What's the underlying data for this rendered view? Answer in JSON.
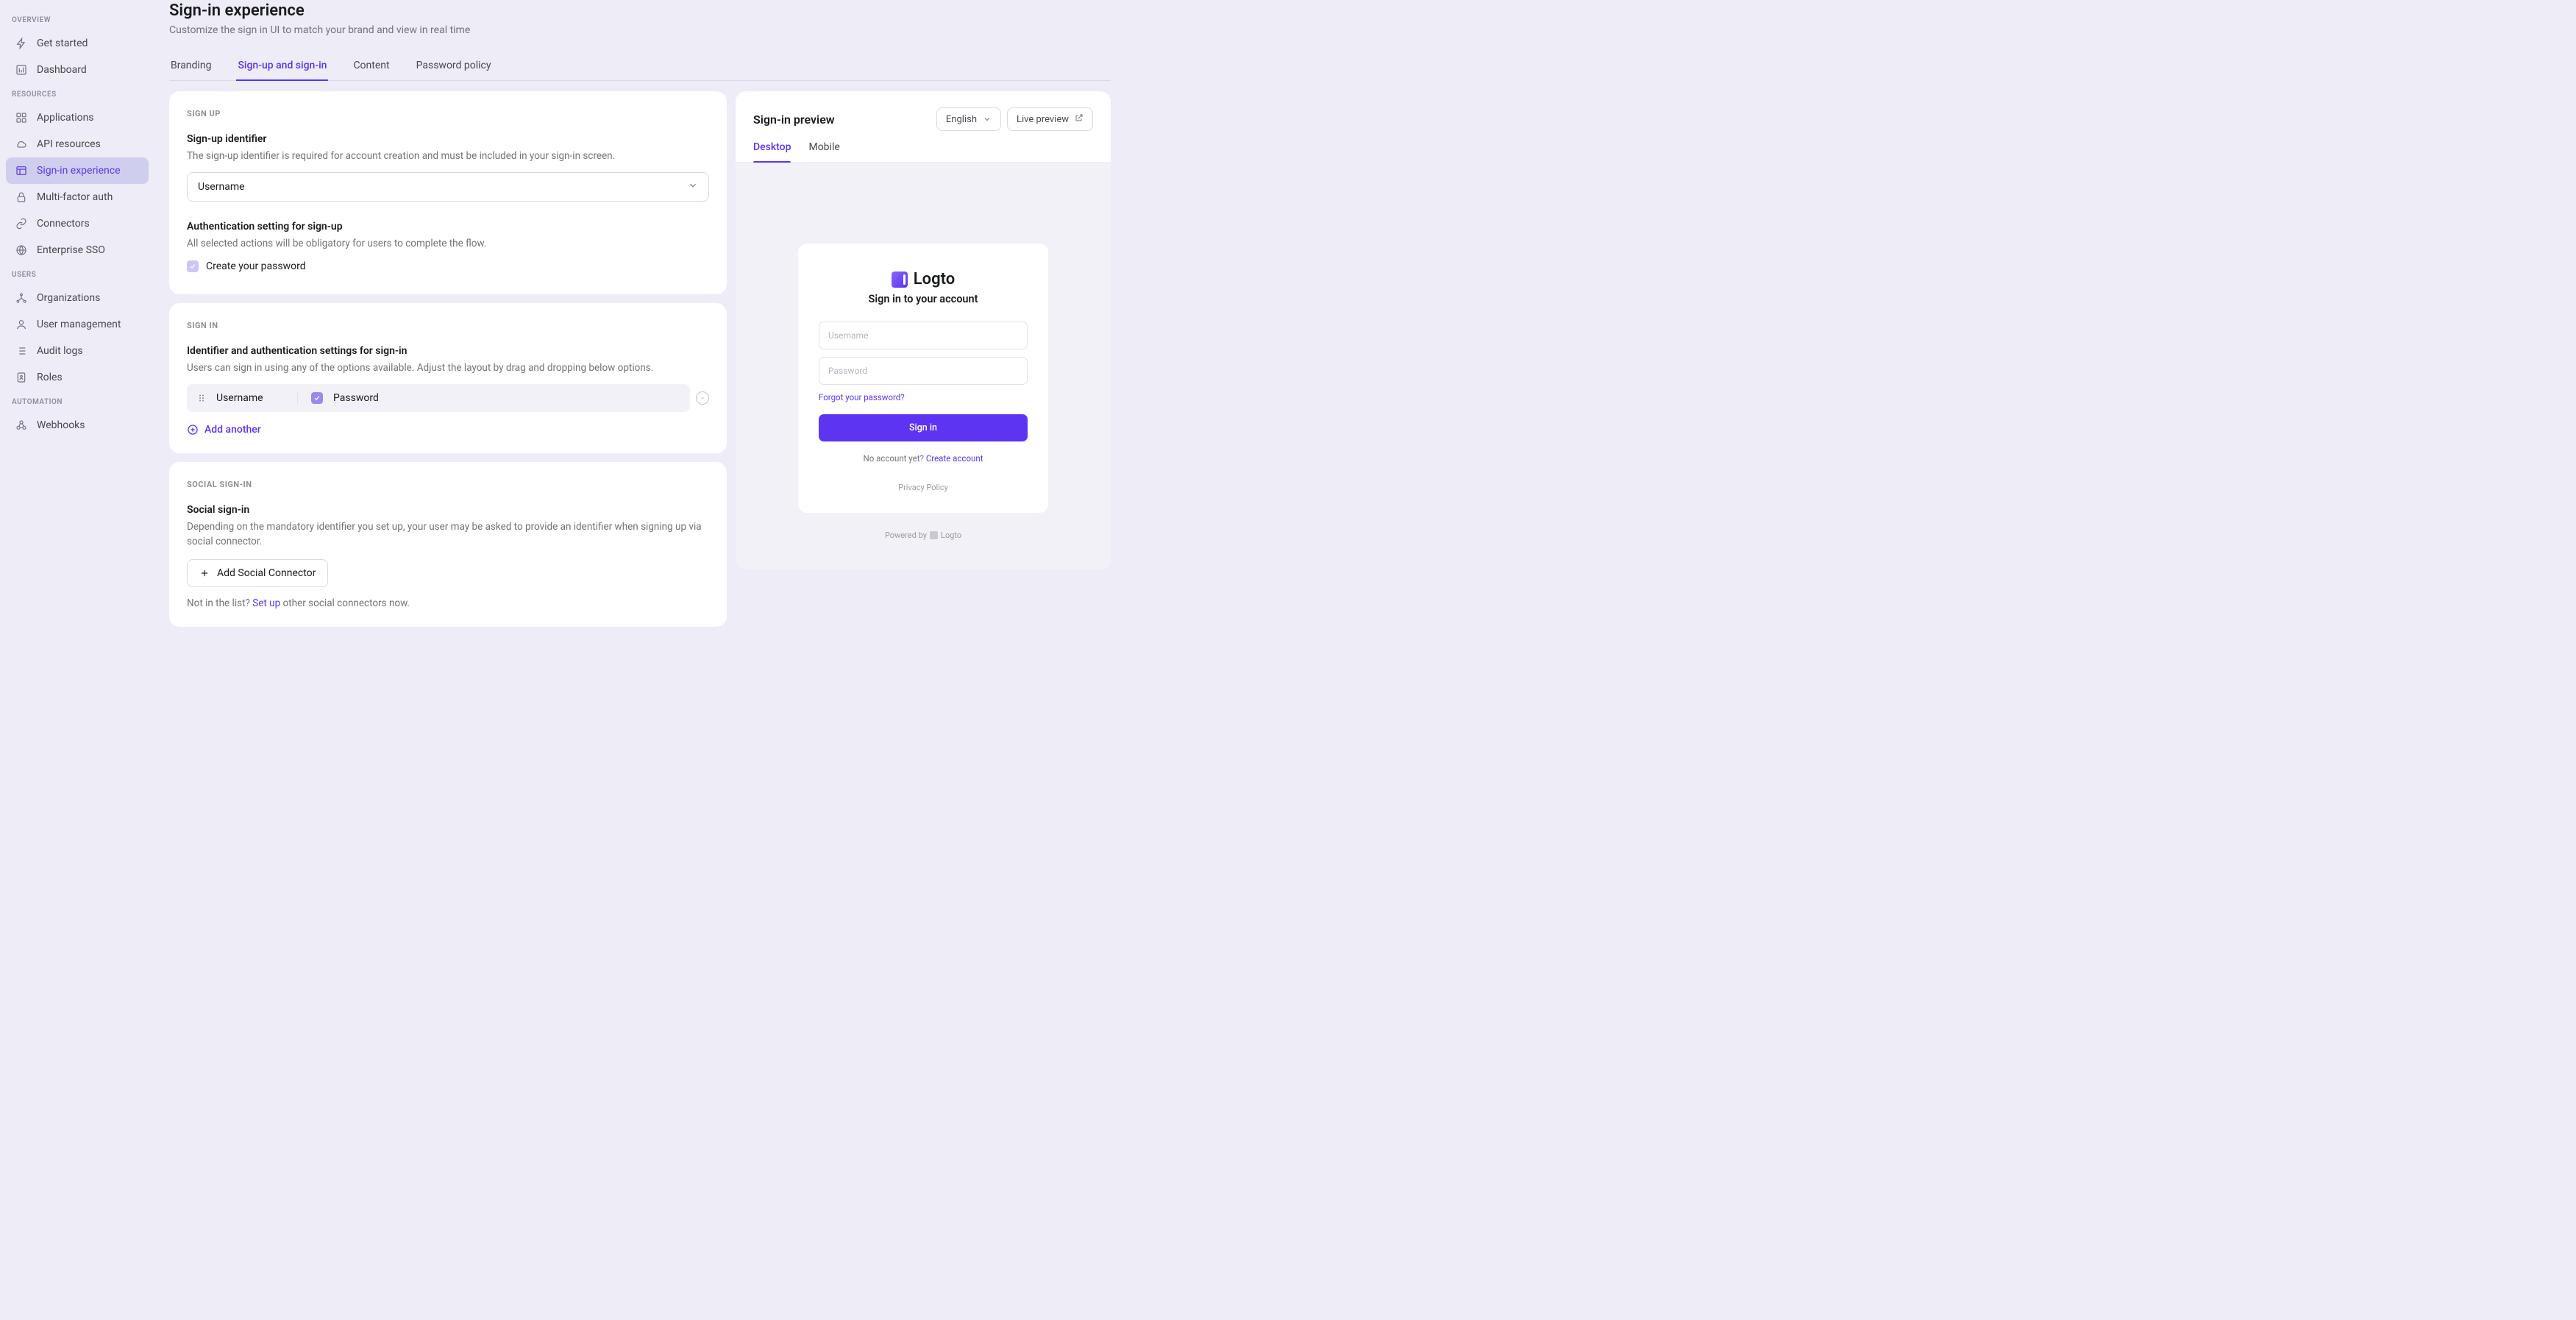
{
  "sidebar": {
    "sections": {
      "overview": {
        "label": "OVERVIEW",
        "items": [
          {
            "label": "Get started"
          },
          {
            "label": "Dashboard"
          }
        ]
      },
      "resources": {
        "label": "RESOURCES",
        "items": [
          {
            "label": "Applications"
          },
          {
            "label": "API resources"
          },
          {
            "label": "Sign-in experience"
          },
          {
            "label": "Multi-factor auth"
          },
          {
            "label": "Connectors"
          },
          {
            "label": "Enterprise SSO"
          }
        ]
      },
      "users": {
        "label": "USERS",
        "items": [
          {
            "label": "Organizations"
          },
          {
            "label": "User management"
          },
          {
            "label": "Audit logs"
          },
          {
            "label": "Roles"
          }
        ]
      },
      "automation": {
        "label": "AUTOMATION",
        "items": [
          {
            "label": "Webhooks"
          }
        ]
      }
    }
  },
  "header": {
    "title": "Sign-in experience",
    "subtitle": "Customize the sign in UI to match your brand and view in real time"
  },
  "tabs": {
    "branding": "Branding",
    "signup_signin": "Sign-up and sign-in",
    "content": "Content",
    "password_policy": "Password policy"
  },
  "signup": {
    "section_label": "SIGN UP",
    "identifier_title": "Sign-up identifier",
    "identifier_desc": "The sign-up identifier is required for account creation and must be included in your sign-in screen.",
    "identifier_value": "Username",
    "auth_title": "Authentication setting for sign-up",
    "auth_desc": "All selected actions will be obligatory for users to complete the flow.",
    "create_password_label": "Create your password"
  },
  "signin": {
    "section_label": "SIGN IN",
    "title": "Identifier and authentication settings for sign-in",
    "desc": "Users can sign in using any of the options available. Adjust the layout by drag and dropping below options.",
    "row_identifier": "Username",
    "row_password": "Password",
    "add_another": "Add another"
  },
  "social": {
    "section_label": "SOCIAL SIGN-IN",
    "title": "Social sign-in",
    "desc": "Depending on the mandatory identifier you set up, your user may be asked to provide an identifier when signing up via social connector.",
    "add_button": "Add Social Connector",
    "hint_prefix": "Not in the list? ",
    "hint_link": "Set up",
    "hint_suffix": " other social connectors now."
  },
  "preview": {
    "title": "Sign-in preview",
    "language": "English",
    "live_preview": "Live preview",
    "tab_desktop": "Desktop",
    "tab_mobile": "Mobile",
    "brand": "Logto",
    "heading": "Sign in to your account",
    "username_placeholder": "Username",
    "password_placeholder": "Password",
    "forgot": "Forgot your password?",
    "signin_button": "Sign in",
    "no_account_prefix": "No account yet? ",
    "create_account": "Create account",
    "privacy": "Privacy Policy",
    "powered_prefix": "Powered by ",
    "powered_brand": "Logto"
  }
}
